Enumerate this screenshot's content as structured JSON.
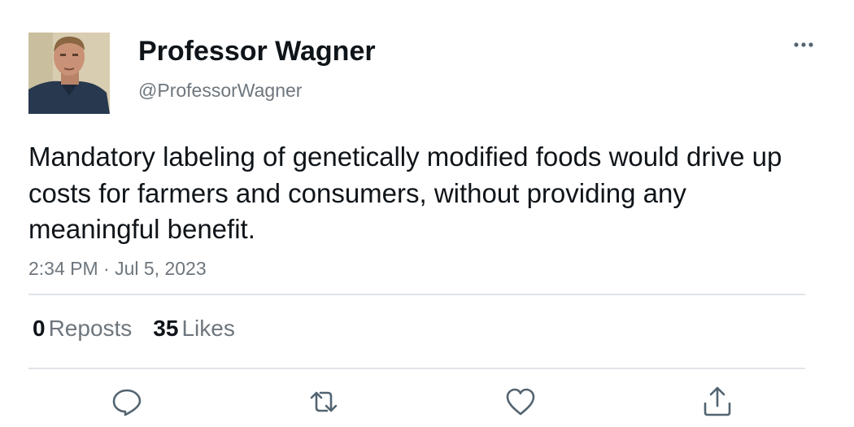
{
  "author": {
    "name": "Professor Wagner",
    "handle": "@ProfessorWagner"
  },
  "tweet": {
    "text": "Mandatory labeling of genetically modified foods would drive up costs for farmers and consumers, without providing any meaningful benefit.",
    "timestamp": "2:34 PM · Jul 5, 2023"
  },
  "stats": {
    "reposts_count": "0",
    "reposts_label": "Reposts",
    "likes_count": "35",
    "likes_label": "Likes"
  },
  "icons": {
    "more": "more-horizontal-icon",
    "reply": "reply-icon",
    "repost": "repost-icon",
    "like": "heart-icon",
    "share": "share-icon"
  },
  "colors": {
    "text_primary": "#0f1419",
    "text_secondary": "#6e767d",
    "divider": "#e1e5e8",
    "icon": "#536471"
  }
}
